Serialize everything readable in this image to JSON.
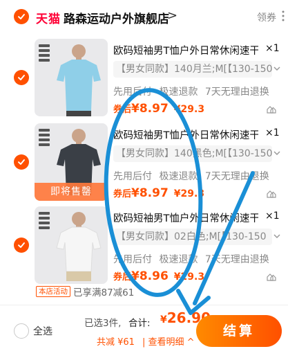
{
  "store": {
    "platform": "天猫",
    "name": "路森运动户外旗舰店",
    "arrow": ">",
    "coupon": "领券"
  },
  "items": [
    {
      "title": "欧码短袖男T恤户外日常休闲速干",
      "qty": "×1",
      "sku": "【男女同款】140月兰;M[【130-150",
      "services": "先用后付 极速退款 7天无理由退换",
      "price_prefix": "券后",
      "price": "¥8.97",
      "orig_price": "¥29.3",
      "shirt_color": "#8fcfe8",
      "sale_tag": ""
    },
    {
      "title": "欧码短袖男T恤户外日常休闲速干",
      "qty": "×1",
      "sku": "【男女同款】140黑色;M[【130-150",
      "services": "先用后付 极速退款 7天无理由退换",
      "price_prefix": "券后",
      "price": "¥8.97",
      "orig_price": "¥29.3",
      "shirt_color": "#3a3f46",
      "sale_tag": "即将售罄"
    },
    {
      "title": "欧码短袖男T恤户外日常休闲速干",
      "qty": "×1",
      "sku": "【男女同款】02白色;M[【130-150",
      "services": "先用后付 极速退款 7天无理由退换",
      "price_prefix": "券后",
      "price": "¥8.96",
      "orig_price": "¥29.3",
      "shirt_color": "#f6f6f6",
      "sale_tag": ""
    }
  ],
  "promo": {
    "tag": "本店活动",
    "text": "已享满87减61"
  },
  "footer": {
    "select_all": "全选",
    "selected_count": "已选3件,",
    "total_label": "合计:",
    "total_symbol": "¥",
    "total_value": "26.90",
    "discount": "共减 ¥61",
    "detail_link": "| 查看明细 ^",
    "checkout": "结算"
  },
  "colors": {
    "accent": "#ff5000",
    "tmall": "#ff0036",
    "annotation": "#1a8fd6"
  },
  "icons": [
    "check-icon",
    "chevron-right-icon",
    "more-icon",
    "chevron-down-icon",
    "similar-icon"
  ]
}
